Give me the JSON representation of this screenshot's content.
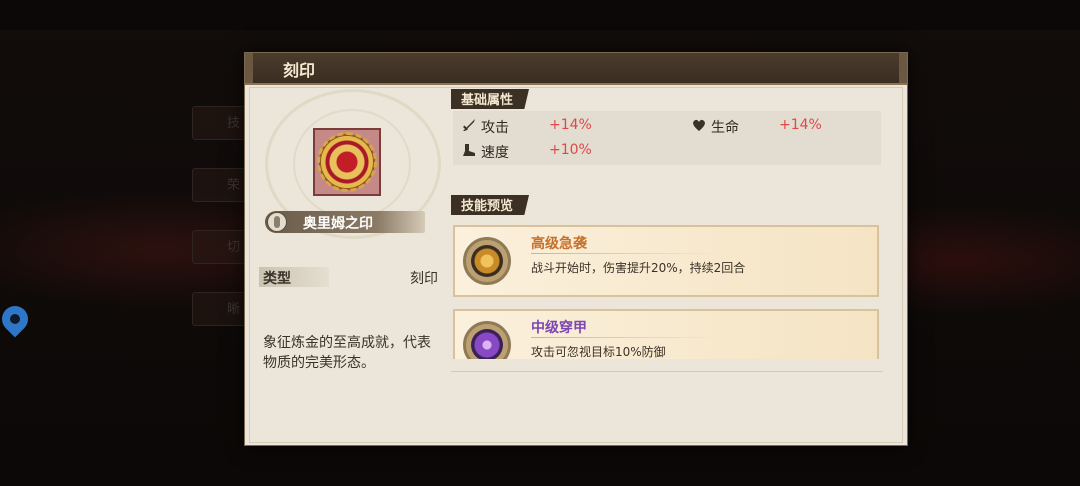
{
  "dialog": {
    "title": "刻印"
  },
  "item": {
    "name": "奥里姆之印",
    "type_label": "类型",
    "type_value": "刻印",
    "description": "象征炼金的至高成就，代表物质的完美形态。"
  },
  "base_attributes": {
    "header": "基础属性",
    "stats": [
      {
        "icon": "sword-icon",
        "name": "攻击",
        "value": "+14%"
      },
      {
        "icon": "heart-icon",
        "name": "生命",
        "value": "+14%"
      },
      {
        "icon": "boot-icon",
        "name": "速度",
        "value": "+10%"
      }
    ]
  },
  "skill_preview": {
    "header": "技能预览",
    "skills": [
      {
        "name": "高级急袭",
        "description": "战斗开始时，伤害提升20%，持续2回合",
        "icon": "dagger-icon",
        "name_color": "#c7702a"
      },
      {
        "name": "中级穿甲",
        "description": "攻击可忽视目标10%防御",
        "icon": "pierce-icon",
        "name_color": "#7c46b4"
      }
    ]
  },
  "background": {
    "side_tabs": [
      "技",
      "荣",
      "切",
      "晰"
    ]
  }
}
